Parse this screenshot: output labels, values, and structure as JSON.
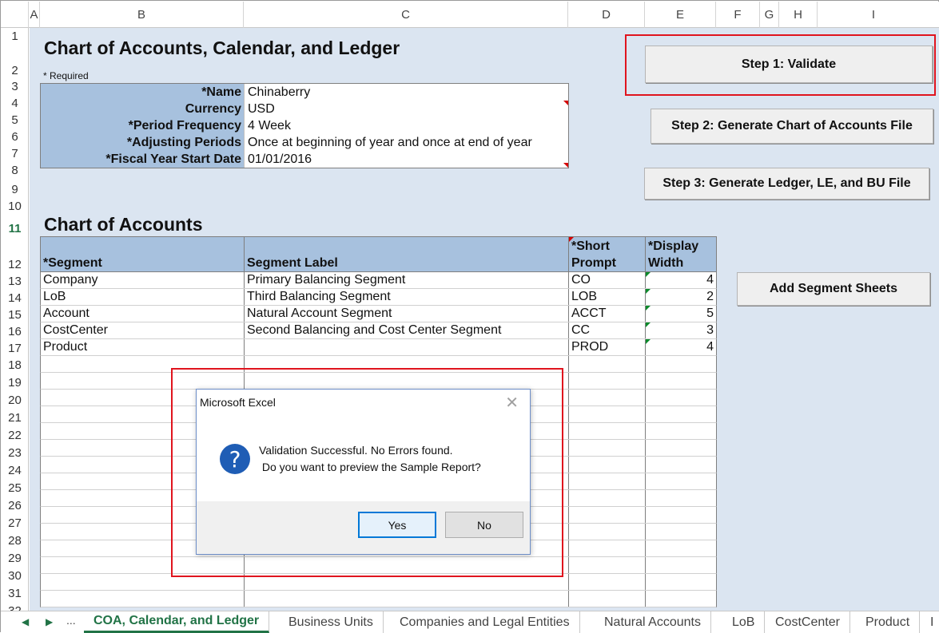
{
  "columns": [
    "A",
    "B",
    "C",
    "D",
    "E",
    "F",
    "G",
    "H",
    "I"
  ],
  "rows": [
    "1",
    "2",
    "3",
    "4",
    "5",
    "6",
    "7",
    "8",
    "9",
    "10",
    "11",
    "12",
    "13",
    "14",
    "15",
    "16",
    "17",
    "18",
    "19",
    "20",
    "21",
    "22",
    "23",
    "24",
    "25",
    "26",
    "27",
    "28",
    "29",
    "30",
    "31",
    "32"
  ],
  "active_row": "11",
  "title_main": "Chart of Accounts, Calendar, and Ledger",
  "required_note": "* Required",
  "form": [
    {
      "label": "*Name",
      "value": "Chinaberry"
    },
    {
      "label": "Currency",
      "value": "USD"
    },
    {
      "label": "*Period Frequency",
      "value": "4 Week"
    },
    {
      "label": "*Adjusting Periods",
      "value": "Once at beginning of year and once at end of year"
    },
    {
      "label": "*Fiscal Year Start Date",
      "value": "01/01/2016"
    }
  ],
  "buttons": {
    "step1": "Step 1: Validate",
    "step2": "Step 2: Generate Chart of Accounts File",
    "step3": "Step 3: Generate Ledger, LE, and BU File",
    "add_segment": "Add Segment Sheets"
  },
  "coa_title": "Chart of Accounts",
  "coa_headers": [
    "*Segment",
    "Segment Label",
    "*Short Prompt",
    "*Display Width"
  ],
  "coa_rows": [
    {
      "segment": "Company",
      "label": "Primary Balancing Segment",
      "prompt": "CO",
      "width": "4"
    },
    {
      "segment": "LoB",
      "label": "Third Balancing Segment",
      "prompt": "LOB",
      "width": "2"
    },
    {
      "segment": "Account",
      "label": "Natural Account Segment",
      "prompt": "ACCT",
      "width": "5"
    },
    {
      "segment": "CostCenter",
      "label": "Second Balancing and Cost Center Segment",
      "prompt": "CC",
      "width": "3"
    },
    {
      "segment": "Product",
      "label": "",
      "prompt": "PROD",
      "width": "4"
    },
    {
      "segment": "",
      "label": "",
      "prompt": "",
      "width": ""
    },
    {
      "segment": "",
      "label": "",
      "prompt": "",
      "width": ""
    },
    {
      "segment": "",
      "label": "",
      "prompt": "",
      "width": ""
    },
    {
      "segment": "",
      "label": "",
      "prompt": "",
      "width": ""
    },
    {
      "segment": "",
      "label": "",
      "prompt": "",
      "width": ""
    },
    {
      "segment": "",
      "label": "",
      "prompt": "",
      "width": ""
    },
    {
      "segment": "",
      "label": "",
      "prompt": "",
      "width": ""
    },
    {
      "segment": "",
      "label": "",
      "prompt": "",
      "width": ""
    },
    {
      "segment": "",
      "label": "",
      "prompt": "",
      "width": ""
    },
    {
      "segment": "",
      "label": "",
      "prompt": "",
      "width": ""
    },
    {
      "segment": "",
      "label": "",
      "prompt": "",
      "width": ""
    },
    {
      "segment": "",
      "label": "",
      "prompt": "",
      "width": ""
    },
    {
      "segment": "",
      "label": "",
      "prompt": "",
      "width": ""
    },
    {
      "segment": "",
      "label": "",
      "prompt": "",
      "width": ""
    },
    {
      "segment": "",
      "label": "",
      "prompt": "",
      "width": ""
    }
  ],
  "dialog": {
    "title": "Microsoft Excel",
    "close": "✕",
    "icon": "question-icon",
    "line1": "Validation Successful. No Errors found.",
    "line2": " Do you want to preview the Sample Report?",
    "yes": "Yes",
    "no": "No"
  },
  "tabs": {
    "nav_prev": "◀",
    "nav_next": "▶",
    "nav_more": "...",
    "items": [
      "COA, Calendar, and Ledger",
      "Business Units",
      "Companies and Legal Entities",
      "Natural Accounts",
      "LoB",
      "CostCenter",
      "Product",
      "I"
    ]
  },
  "colors": {
    "accent": "#217346",
    "highlight": "#e0141e",
    "header_fill": "#a7c1de",
    "sheet_bg": "#dbe5f1"
  }
}
